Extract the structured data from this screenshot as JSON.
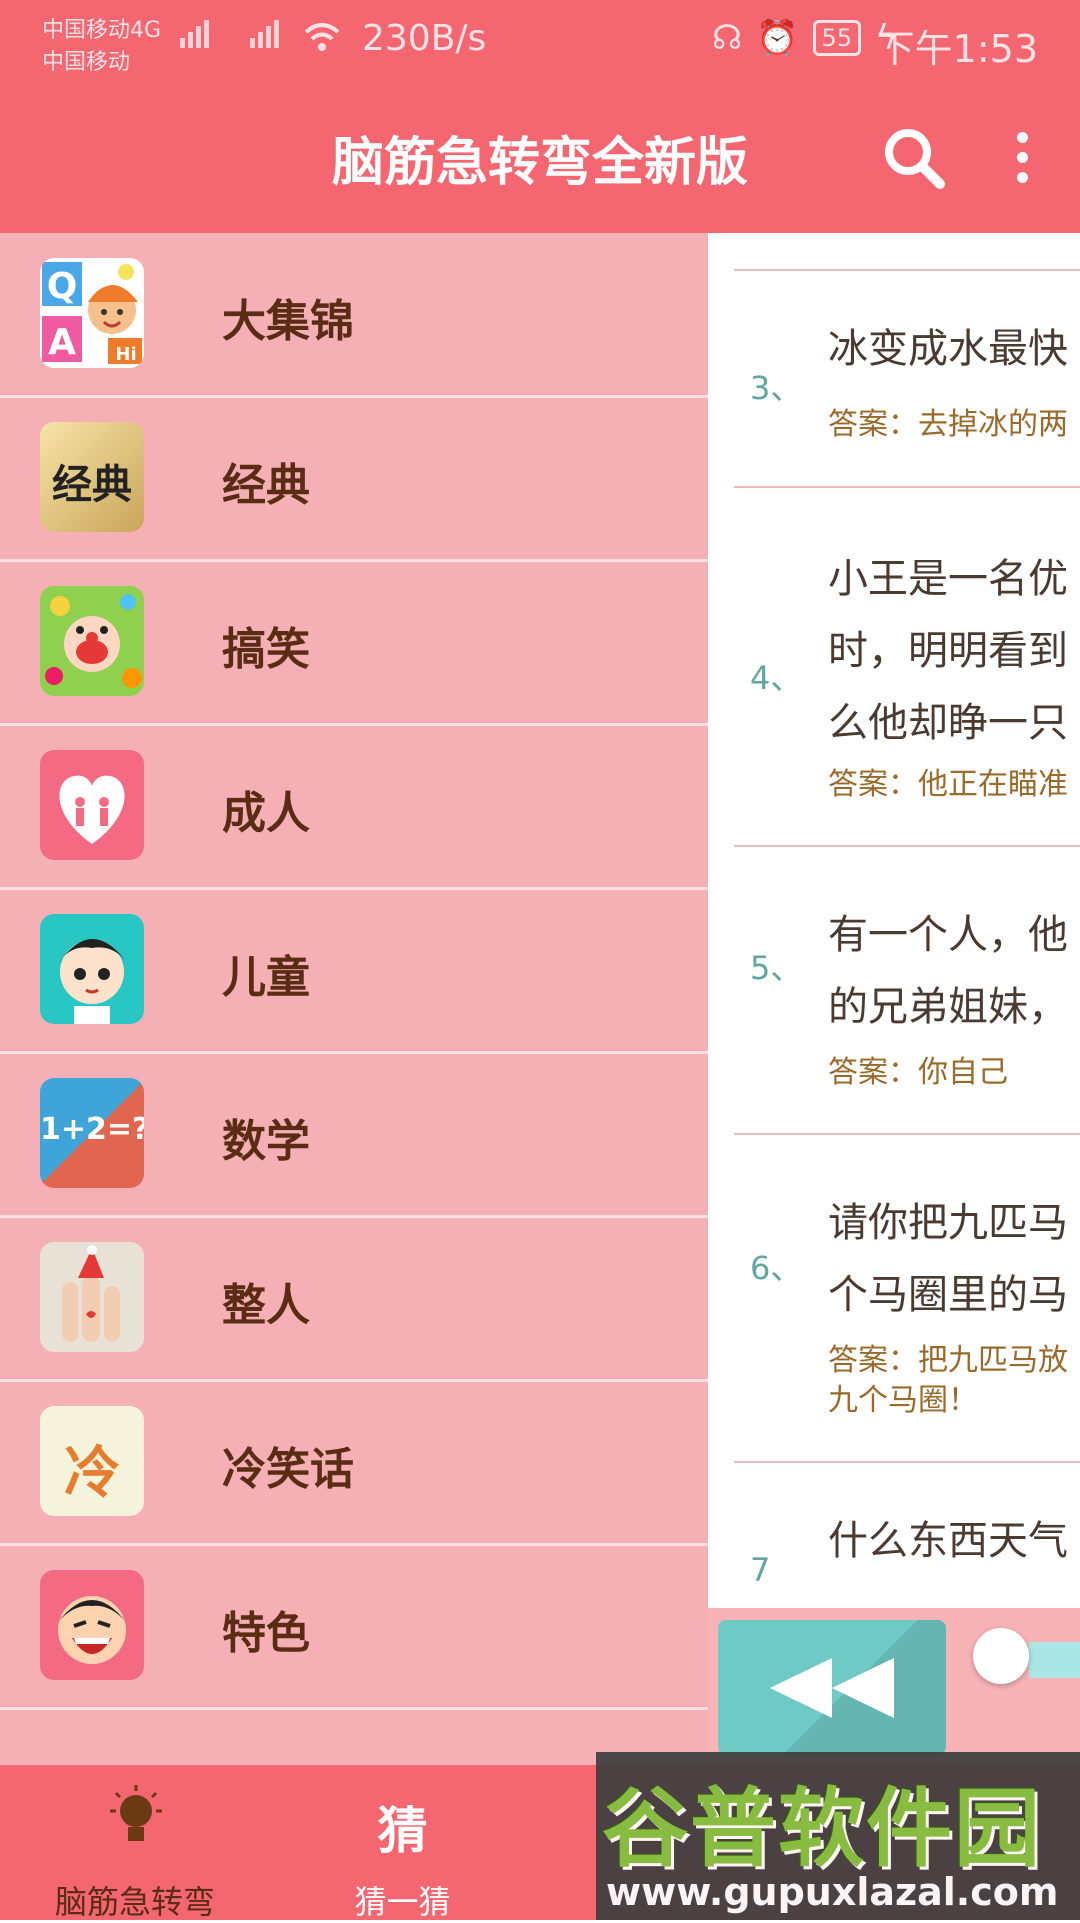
{
  "status_bar": {
    "carrier_1": "中国移动4G",
    "carrier_2": "中国移动",
    "net_speed": "230B/s",
    "battery": "55",
    "time": "下午1:53",
    "icons": [
      "headset-icon",
      "alarm-icon",
      "battery-icon",
      "charging-icon"
    ]
  },
  "header": {
    "title": "脑筋急转弯全新版",
    "search_icon": "search-icon",
    "menu_icon": "more-vert-icon"
  },
  "drawer": {
    "items": [
      {
        "label": "大集锦",
        "icon": "qa-cartoon-icon"
      },
      {
        "label": "经典",
        "icon": "classic-calligraphy-icon"
      },
      {
        "label": "搞笑",
        "icon": "funny-clown-icon"
      },
      {
        "label": "成人",
        "icon": "heart-couple-icon"
      },
      {
        "label": "儿童",
        "icon": "child-face-icon"
      },
      {
        "label": "数学",
        "icon": "math-icon"
      },
      {
        "label": "整人",
        "icon": "finger-puppets-icon"
      },
      {
        "label": "冷笑话",
        "icon": "cold-joke-icon"
      },
      {
        "label": "特色",
        "icon": "laughing-man-icon"
      }
    ],
    "math_icon_text": "1+2=?",
    "classic_icon_text": "经典",
    "cold_icon_text": "冷"
  },
  "questions": [
    {
      "num": "3、",
      "lines": [
        "冰变成水最快"
      ],
      "answer": [
        "答案：去掉冰的两"
      ]
    },
    {
      "num": "4、",
      "lines": [
        "小王是一名优",
        "时，明明看到",
        "么他却睁一只"
      ],
      "answer": [
        "答案：他正在瞄准"
      ]
    },
    {
      "num": "5、",
      "lines": [
        "有一个人，他",
        "的兄弟姐妹，"
      ],
      "answer": [
        "答案：你自己"
      ]
    },
    {
      "num": "6、",
      "lines": [
        "请你把九匹马",
        "个马圈里的马"
      ],
      "answer": [
        "答案：把九匹马放",
        "九个马圈！"
      ]
    },
    {
      "num": "7",
      "lines": [
        "什么东西天气"
      ],
      "answer": []
    }
  ],
  "player": {
    "rewind_icon": "rewind-icon"
  },
  "bottom_nav": {
    "items": [
      {
        "label": "脑筋急转弯",
        "icon": "lightbulb-icon"
      },
      {
        "label": "猜一猜",
        "icon": "guess-icon",
        "glyph": "猜"
      }
    ]
  },
  "watermark": {
    "brand": "谷普软件园",
    "url": "www.gupuxlazal.com"
  },
  "colors": {
    "primary": "#f46670",
    "drawer_bg": "#f4b0b5",
    "label": "#5a2c14",
    "accent_teal": "#6fcac6"
  }
}
